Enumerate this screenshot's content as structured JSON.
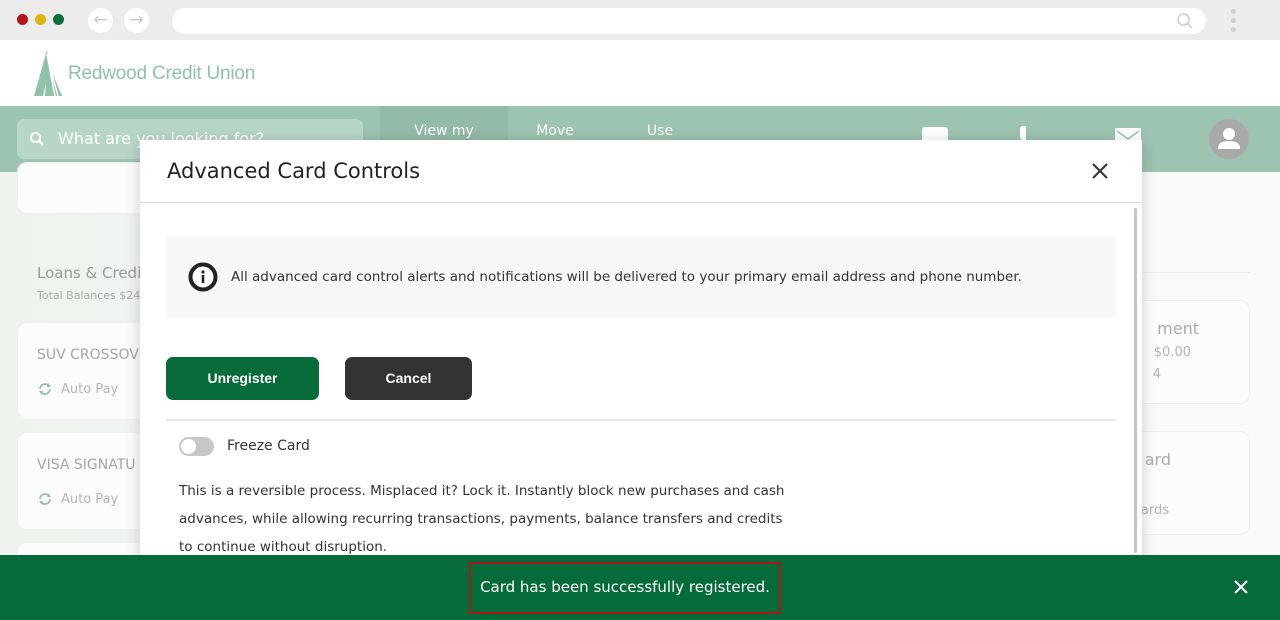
{
  "browser": {
    "url": "",
    "back_icon": "arrow-left-icon",
    "forward_icon": "arrow-right-icon"
  },
  "site": {
    "brand": "Redwood Credit Union",
    "search_placeholder": "What are you looking for?",
    "nav_tabs": [
      {
        "label": "View my",
        "active": true
      },
      {
        "label": "Move",
        "active": false
      },
      {
        "label": "Use",
        "active": false
      }
    ],
    "colors": {
      "brand_light": "#9dc4b0",
      "brand_dark": "#076b3a"
    }
  },
  "background": {
    "section_title": "Loans & Credi",
    "section_subtitle": "Total Balances $24",
    "left_cards": [
      {
        "name": "SUV CROSSOV",
        "autopay": "Auto Pay"
      },
      {
        "name": "VISA SIGNATU",
        "autopay": "Auto Pay"
      }
    ],
    "right_cards": [
      {
        "title": "ment",
        "line1": "$0.00",
        "line2": "4"
      },
      {
        "title": "ard",
        "line1": "ards"
      }
    ]
  },
  "modal": {
    "title": "Advanced Card Controls",
    "info_text": "All advanced card control alerts and notifications will be delivered to your primary email address and phone number.",
    "unregister_label": "Unregister",
    "cancel_label": "Cancel",
    "freeze_label": "Freeze Card",
    "freeze_on": false,
    "description": "This is a reversible process. Misplaced it? Lock it. Instantly block new purchases and cash advances, while allowing recurring transactions, payments, balance transfers and credits to continue without disruption."
  },
  "toast": {
    "message": "Card has been successfully registered.",
    "close_label": "X"
  }
}
